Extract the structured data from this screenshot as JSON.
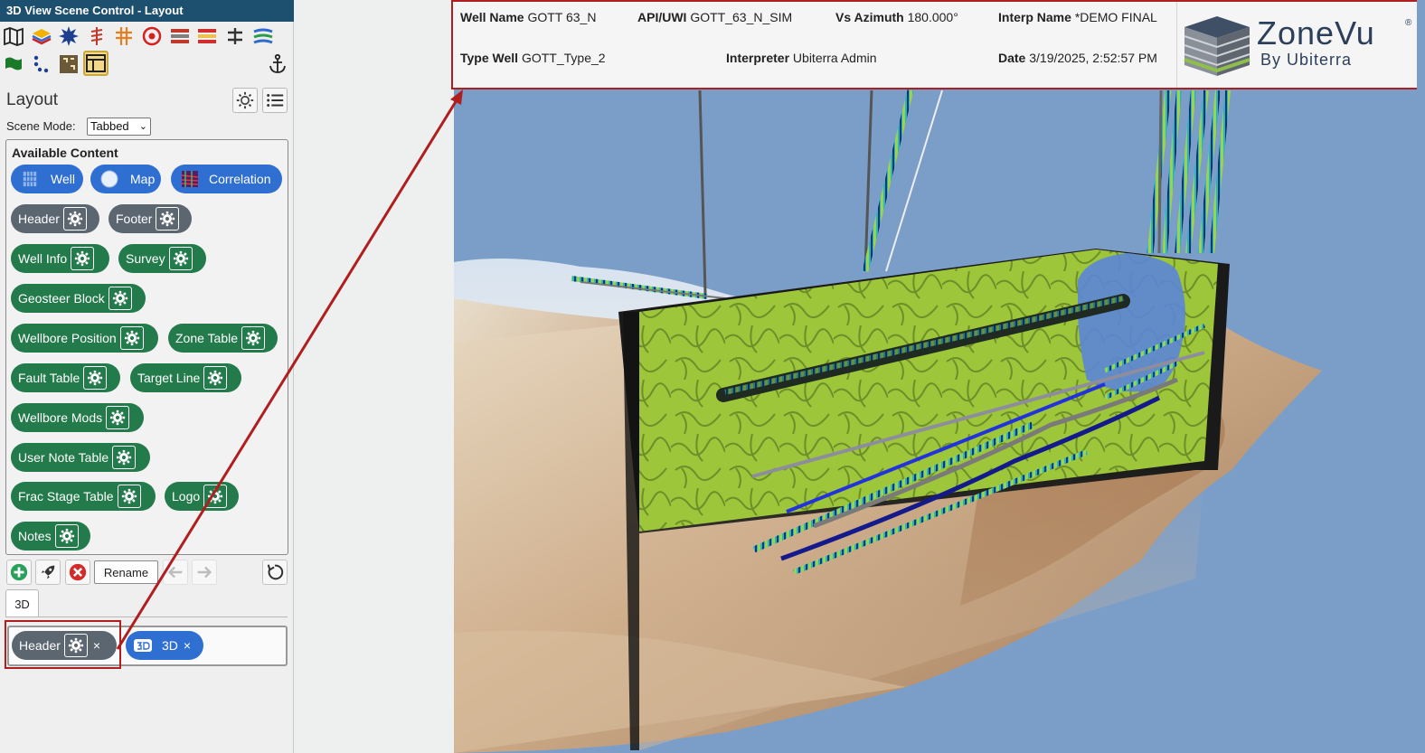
{
  "window": {
    "title": "3D View Scene Control - Layout"
  },
  "toolbar": {
    "icons": [
      "map-icon",
      "layers-icon",
      "star-burst-icon",
      "well-sticks-icon",
      "well-cross-icon",
      "target-icon",
      "stripes-icon",
      "stripes-red-icon",
      "separator-icon",
      "stripes-blue-icon",
      "flag-icon",
      "dots-icon",
      "grid-map-icon",
      "layout-icon",
      "anchor-icon"
    ]
  },
  "layout": {
    "title": "Layout",
    "scene_mode_label": "Scene Mode:",
    "scene_mode_value": "Tabbed",
    "available_title": "Available Content",
    "content_items": [
      {
        "label": "Well",
        "type": "blue"
      },
      {
        "label": "Map",
        "type": "blue"
      },
      {
        "label": "Correlation",
        "type": "blue"
      },
      {
        "label": "Header",
        "type": "gray"
      },
      {
        "label": "Footer",
        "type": "gray"
      },
      {
        "label": "Well Info",
        "type": "green"
      },
      {
        "label": "Survey",
        "type": "green"
      },
      {
        "label": "Geosteer Block",
        "type": "green"
      },
      {
        "label": "Wellbore Position",
        "type": "green"
      },
      {
        "label": "Zone Table",
        "type": "green"
      },
      {
        "label": "Fault Table",
        "type": "green"
      },
      {
        "label": "Target Line",
        "type": "green"
      },
      {
        "label": "Wellbore Mods",
        "type": "green"
      },
      {
        "label": "User Note Table",
        "type": "green"
      },
      {
        "label": "Frac Stage Table",
        "type": "green"
      },
      {
        "label": "Logo",
        "type": "green"
      },
      {
        "label": "Notes",
        "type": "green"
      }
    ],
    "rename_label": "Rename",
    "tab_label": "3D",
    "placed": [
      {
        "label": "Header",
        "type": "gray"
      },
      {
        "label": "3D",
        "type": "blue"
      }
    ],
    "remove_symbol": "×"
  },
  "header": {
    "well_name_label": "Well Name",
    "well_name": "GOTT 63_N",
    "api_label": "API/UWI",
    "api": "GOTT_63_N_SIM",
    "vs_azimuth_label": "Vs Azimuth",
    "vs_azimuth": "180.000°",
    "interp_name_label": "Interp Name",
    "interp_name": "*DEMO FINAL",
    "type_well_label": "Type Well",
    "type_well": "GOTT_Type_2",
    "interpreter_label": "Interpreter",
    "interpreter": "Ubiterra Admin",
    "date_label": "Date",
    "date": "3/19/2025, 2:52:57 PM"
  },
  "logo": {
    "brand_a": "Zone",
    "brand_b": "Vu",
    "sub": "By Ubiterra",
    "reg": "®"
  },
  "colors": {
    "title_bar": "#1d4f6e",
    "pill_blue": "#2f6fd2",
    "pill_green": "#237a4b",
    "pill_gray": "#5c6670",
    "highlight": "#b01e1e",
    "sky": "#7b9ec9"
  }
}
